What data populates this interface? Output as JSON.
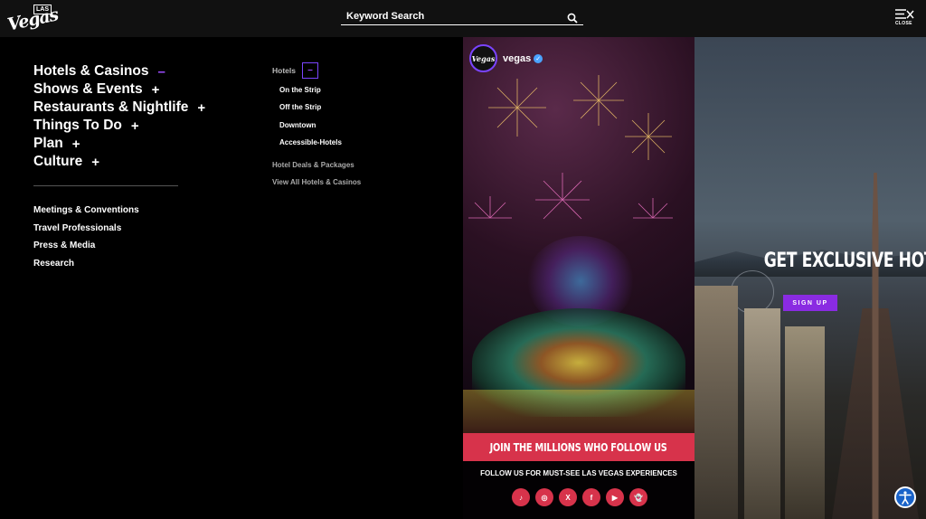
{
  "header": {
    "logo_text": "Vegas",
    "logo_badge": "LAS",
    "search_placeholder": "Keyword Search",
    "close_label": "CLOSE"
  },
  "primary_nav": [
    {
      "label": "Hotels & Casinos",
      "toggle": "–",
      "expanded": true
    },
    {
      "label": "Shows & Events",
      "toggle": "+",
      "expanded": false
    },
    {
      "label": "Restaurants & Nightlife",
      "toggle": "+",
      "expanded": false
    },
    {
      "label": "Things To Do",
      "toggle": "+",
      "expanded": false
    },
    {
      "label": "Plan",
      "toggle": "+",
      "expanded": false
    },
    {
      "label": "Culture",
      "toggle": "+",
      "expanded": false
    }
  ],
  "secondary_nav": [
    "Meetings & Conventions",
    "Travel Professionals",
    "Press & Media",
    "Research"
  ],
  "sub_nav": {
    "heading": "Hotels",
    "collapse": "–",
    "items": [
      "On the Strip",
      "Off the Strip",
      "Downtown",
      "Accessible-Hotels"
    ],
    "extras": [
      "Hotel Deals & Packages",
      "View All Hotels & Casinos"
    ]
  },
  "social": {
    "avatar_text": "Vegas",
    "account_name": "vegas",
    "join_banner": "JOIN THE MILLIONS WHO FOLLOW US",
    "follow_text": "FOLLOW US FOR MUST-SEE LAS VEGAS EXPERIENCES",
    "icons": [
      {
        "name": "tiktok-icon",
        "glyph": "♪"
      },
      {
        "name": "instagram-icon",
        "glyph": "◎"
      },
      {
        "name": "x-icon",
        "glyph": "X"
      },
      {
        "name": "facebook-icon",
        "glyph": "f"
      },
      {
        "name": "youtube-icon",
        "glyph": "▶"
      },
      {
        "name": "snapchat-icon",
        "glyph": "👻"
      }
    ]
  },
  "promo": {
    "headline": "GET EXCLUSIVE HOTEL DEALS & UPDATES",
    "button": "SIGN UP"
  },
  "colors": {
    "accent_purple": "#8a2be2",
    "social_red": "#d7334b",
    "accessibility_blue": "#1a63c9"
  }
}
